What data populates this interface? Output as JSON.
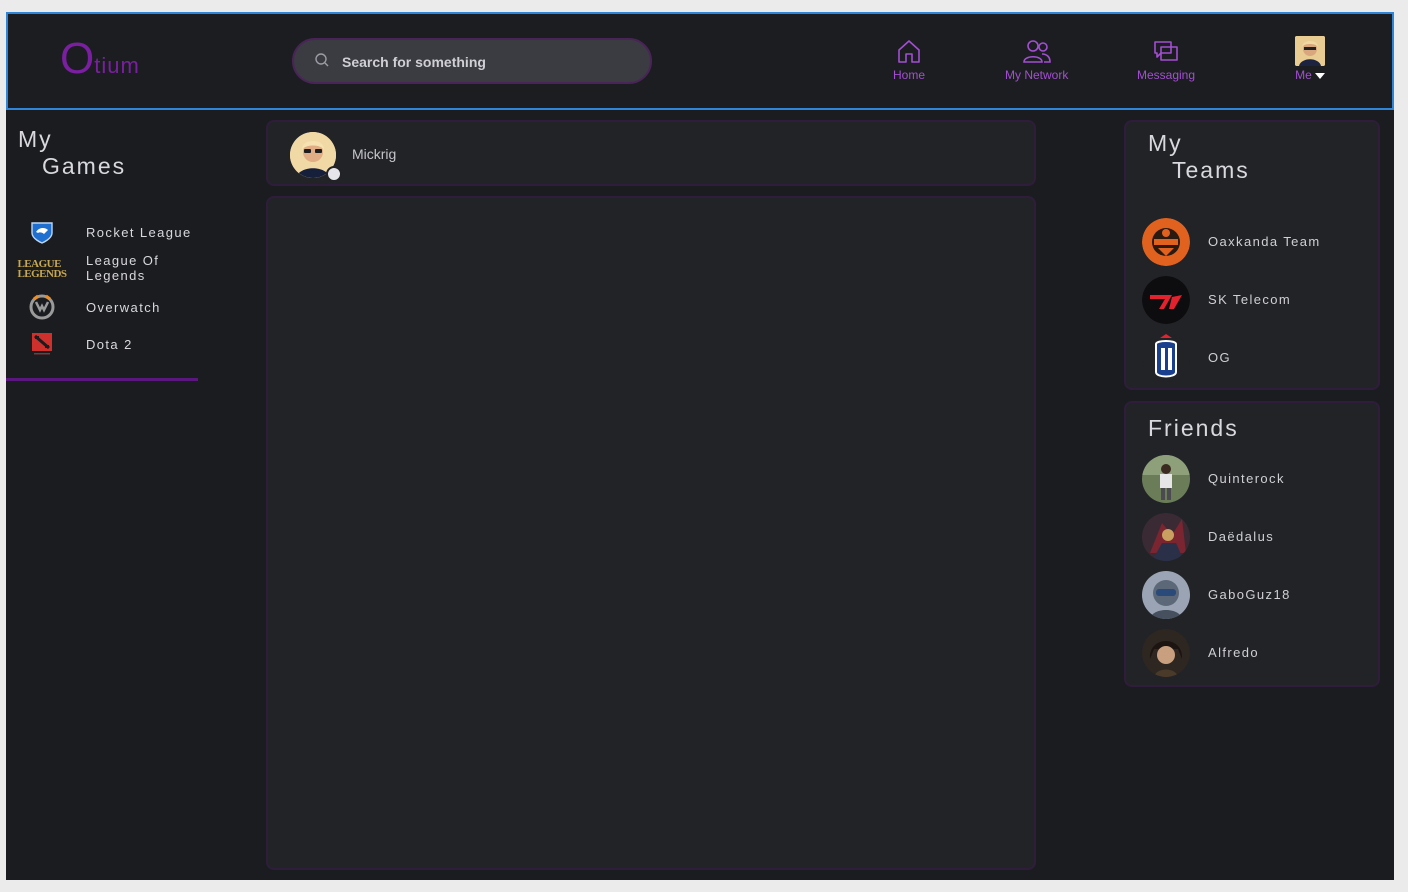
{
  "app": {
    "logo_big": "O",
    "logo_small": "tium"
  },
  "search": {
    "placeholder": "Search for something",
    "value": ""
  },
  "nav": {
    "home": "Home",
    "network": "My Network",
    "messaging": "Messaging",
    "me": "Me"
  },
  "games": {
    "title_line1": "My",
    "title_line2": "Games",
    "items": [
      {
        "label": "Rocket League",
        "icon": "rocket-league-icon"
      },
      {
        "label": "League Of\nLegends",
        "icon": "league-of-legends-icon",
        "icon_text": "LEAGUE\nLEGENDS"
      },
      {
        "label": "Overwatch",
        "icon": "overwatch-icon"
      },
      {
        "label": "Dota 2",
        "icon": "dota-2-icon"
      }
    ]
  },
  "current_user": {
    "name": "Mickrig",
    "status": "online"
  },
  "teams": {
    "title_line1": "My",
    "title_line2": "Teams",
    "items": [
      {
        "name": "Oaxkanda Team",
        "color": "#e0621e"
      },
      {
        "name": "SK Telecom",
        "color": "#e3222e"
      },
      {
        "name": "OG",
        "color": "#ffffff"
      }
    ]
  },
  "friends": {
    "title": "Friends",
    "items": [
      {
        "name": "Quinterock"
      },
      {
        "name": "Daëdalus"
      },
      {
        "name": "GaboGuz18"
      },
      {
        "name": "Alfredo"
      }
    ]
  },
  "colors": {
    "accent": "#7a1fa0",
    "nav_label": "#a24fd1",
    "header_border": "#2f86d8",
    "background": "#1b1c20",
    "card": "#222327"
  }
}
